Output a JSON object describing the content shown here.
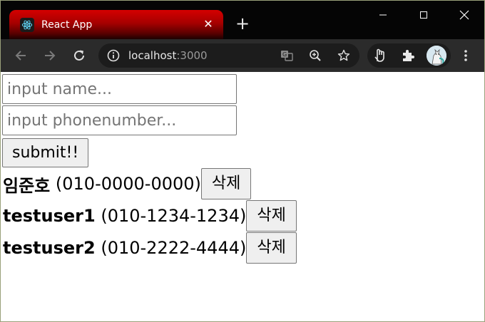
{
  "browser": {
    "tab_title": "React App",
    "url_host": "localhost",
    "url_port": ":3000"
  },
  "form": {
    "name_placeholder": "input name...",
    "phone_placeholder": "input phonenumber...",
    "submit_label": "submit!!"
  },
  "contacts": [
    {
      "name": "임준호",
      "phone": "(010-0000-0000)",
      "delete_label": "삭제"
    },
    {
      "name": "testuser1",
      "phone": "(010-1234-1234)",
      "delete_label": "삭제"
    },
    {
      "name": "testuser2",
      "phone": "(010-2222-4444)",
      "delete_label": "삭제"
    }
  ],
  "icons": {
    "favicon": "react-logo-icon",
    "tab_close": "close-icon",
    "new_tab": "plus-icon",
    "back": "arrow-left-icon",
    "forward": "arrow-right-icon",
    "reload": "reload-icon",
    "site_info": "info-icon",
    "translate": "translate-icon",
    "zoom": "zoom-icon",
    "bookmark": "star-icon",
    "extension_1": "hand-icon",
    "extensions": "puzzle-icon",
    "profile": "avatar",
    "menu": "more-vertical-icon"
  },
  "colors": {
    "tab_red": "#d40000",
    "tab_strip": "#050505",
    "toolbar": "#2b2b2b",
    "omnibox": "#1c1c1c",
    "button_bg": "#efefef"
  }
}
